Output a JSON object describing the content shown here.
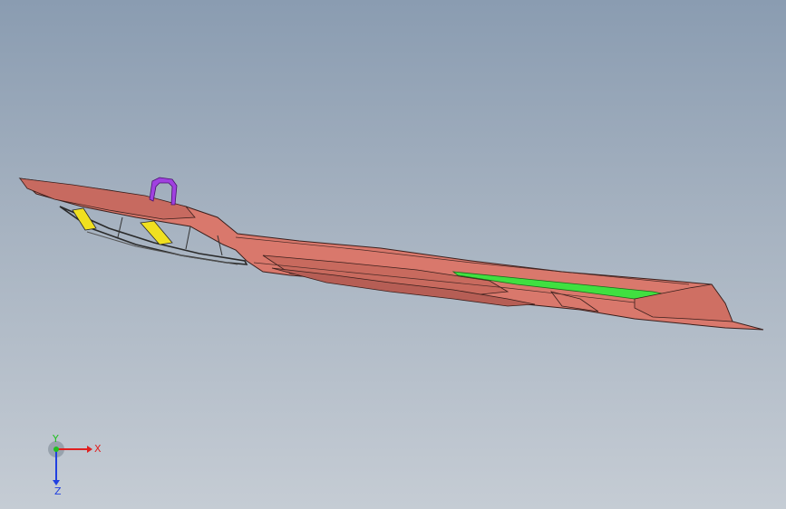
{
  "viewport": {
    "background_top": "#8a9cb1",
    "background_bottom": "#c5ccd4"
  },
  "model": {
    "part_color": "#d9786c",
    "part_edge_color": "#3a1f1c",
    "bracket_color": "#a040e0",
    "clip_color": "#f0e020",
    "highlight_color": "#40e040"
  },
  "triad": {
    "x_label": "X",
    "y_label": "Y",
    "z_label": "Z",
    "x_color": "#e02020",
    "y_color": "#20c020",
    "z_color": "#2040e0"
  }
}
